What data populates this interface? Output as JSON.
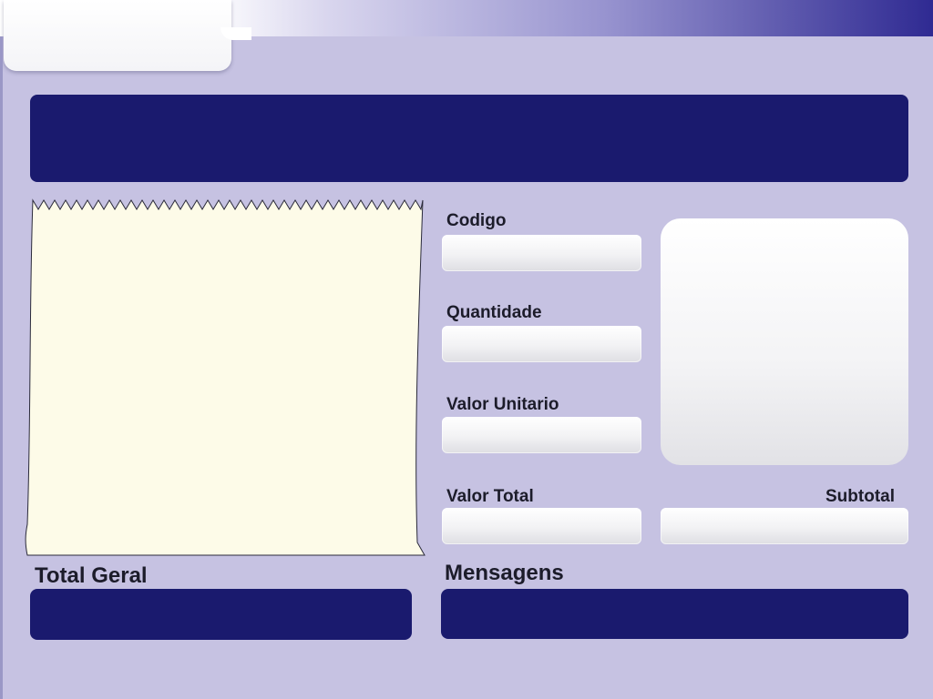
{
  "form": {
    "codigo_label": "Codigo",
    "codigo_value": "",
    "quantidade_label": "Quantidade",
    "quantidade_value": "",
    "valor_unitario_label": "Valor Unitario",
    "valor_unitario_value": "",
    "valor_total_label": "Valor Total",
    "valor_total_value": "",
    "subtotal_label": "Subtotal",
    "subtotal_value": ""
  },
  "footer": {
    "total_geral_label": "Total Geral",
    "mensagens_label": "Mensagens"
  },
  "colors": {
    "background": "#c6c2e2",
    "panel": "#1a1a6e",
    "receipt": "#fdfbe8"
  }
}
